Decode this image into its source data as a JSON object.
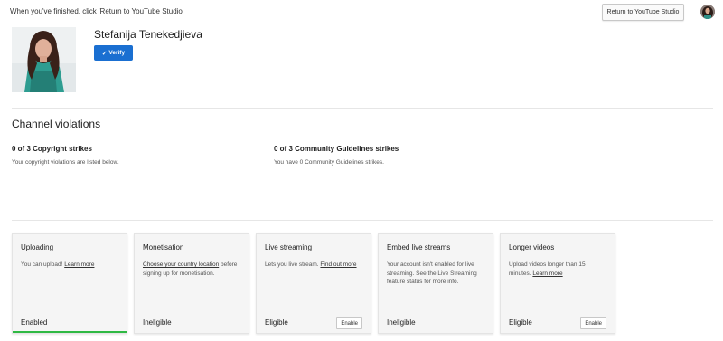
{
  "topbar": {
    "message": "When you've finished, click 'Return to YouTube Studio'",
    "return_button": "Return to YouTube Studio"
  },
  "channel": {
    "name": "Stefanija Tenekedjieva",
    "verify_label": "Verify",
    "verify_color": "#1a6fd1"
  },
  "violations": {
    "title": "Channel violations",
    "copyright": {
      "title": "0 of 3 Copyright strikes",
      "desc": "Your copyright violations are listed below."
    },
    "community": {
      "title": "0 of 3 Community Guidelines strikes",
      "desc": "You have 0 Community Guidelines strikes."
    }
  },
  "features": [
    {
      "title": "Uploading",
      "desc_pre": "You can upload! ",
      "link": "Learn more",
      "desc_post": "",
      "status": "Enabled",
      "button": ""
    },
    {
      "title": "Monetisation",
      "desc_pre": "",
      "link": "Choose your country location",
      "desc_post": " before signing up for monetisation.",
      "status": "Ineligible",
      "button": ""
    },
    {
      "title": "Live streaming",
      "desc_pre": "Lets you live stream. ",
      "link": "Find out more",
      "desc_post": "",
      "status": "Eligible",
      "button": "Enable"
    },
    {
      "title": "Embed live streams",
      "desc_pre": "Your account isn't enabled for live streaming. See the Live Streaming feature status for more info.",
      "link": "",
      "desc_post": "",
      "status": "Ineligible",
      "button": ""
    },
    {
      "title": "Longer videos",
      "desc_pre": "Upload videos longer than 15 minutes. ",
      "link": "Learn more",
      "desc_post": "",
      "status": "Eligible",
      "button": "Enable"
    }
  ],
  "colors": {
    "enabled_bar": "#2fb944"
  }
}
